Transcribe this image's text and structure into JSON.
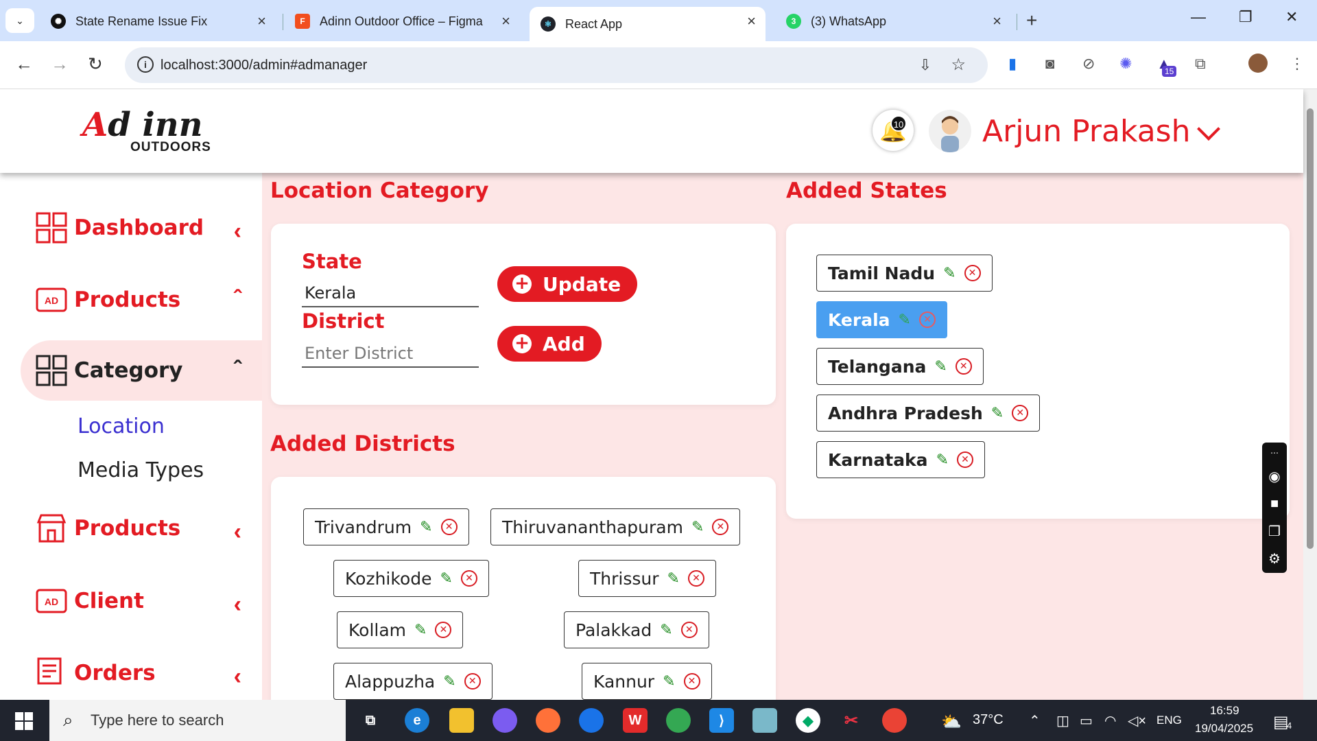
{
  "browser": {
    "tabs": [
      {
        "title": "State Rename Issue Fix",
        "icon": "openai-icon"
      },
      {
        "title": "Adinn Outdoor Office – Figma",
        "icon": "figma-icon"
      },
      {
        "title": "React App",
        "icon": "react-icon",
        "active": true
      },
      {
        "title": "(3) WhatsApp",
        "icon": "whatsapp-icon"
      }
    ],
    "url": "localhost:3000/admin#admanager",
    "ext_badge": "15"
  },
  "header": {
    "logo_main": "Ad inn",
    "logo_sub": "OUTDOORS",
    "notification_count": "10",
    "user_name": "Arjun Prakash"
  },
  "sidebar": {
    "items": [
      {
        "label": "Dashboard",
        "icon": "dashboard-grid-icon",
        "chev": "<"
      },
      {
        "label": "Products",
        "icon": "ad-icon",
        "chev": "^"
      },
      {
        "label": "Category",
        "icon": "category-grid-icon",
        "chev": "^"
      },
      {
        "label": "Products",
        "icon": "store-icon",
        "chev": "<"
      },
      {
        "label": "Client",
        "icon": "ad-icon",
        "chev": "<"
      },
      {
        "label": "Orders",
        "icon": "cart-list-icon",
        "chev": "<"
      }
    ],
    "sub_items": [
      "Location",
      "Media Types"
    ]
  },
  "location_form": {
    "title": "Location Category",
    "state_label": "State",
    "state_value": "Kerala",
    "district_label": "District",
    "district_placeholder": "Enter District",
    "update_label": "Update",
    "add_label": "Add"
  },
  "added_districts": {
    "title": "Added Districts",
    "items": [
      "Trivandrum",
      "Thiruvananthapuram",
      "Kozhikode",
      "Thrissur",
      "Kollam",
      "Palakkad",
      "Alappuzha",
      "Kannur"
    ]
  },
  "added_states": {
    "title": "Added States",
    "items": [
      "Tamil Nadu",
      "Kerala",
      "Telangana",
      "Andhra Pradesh",
      "Karnataka"
    ],
    "selected": "Kerala"
  },
  "taskbar": {
    "search_placeholder": "Type here to search",
    "weather": "37°C",
    "lang": "ENG",
    "time": "16:59",
    "date": "19/04/2025",
    "notif_count": "4"
  },
  "colors": {
    "brand_red": "#e31b23",
    "selected_blue": "#4a9ff0",
    "content_bg": "#fde6e6"
  }
}
